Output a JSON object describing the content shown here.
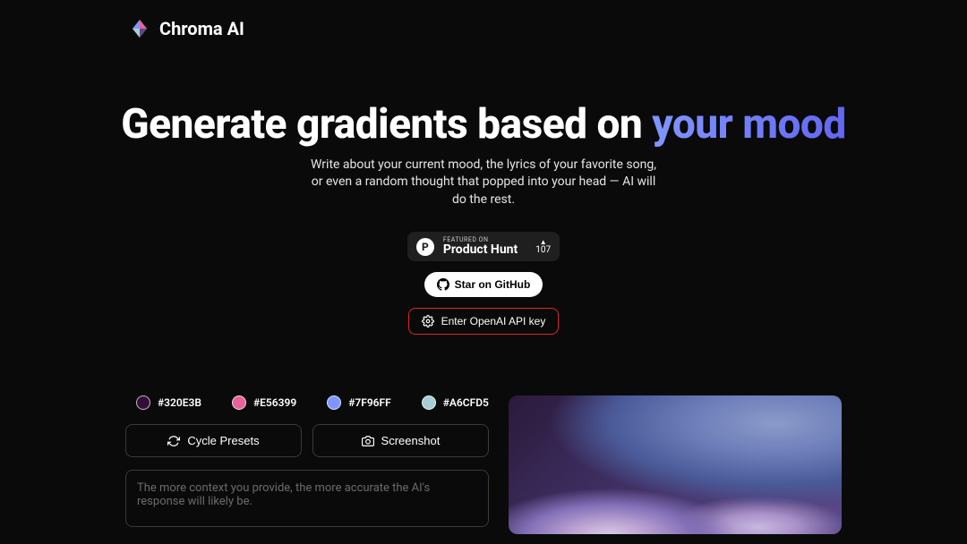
{
  "brand": "Chroma AI",
  "hero": {
    "title_prefix": "Generate gradients based on ",
    "title_highlight": "your mood",
    "subtitle": "Write about your current mood, the lyrics of your favorite song, or even a random thought that popped into your head — AI will do the rest."
  },
  "productHunt": {
    "featured_label": "FEATURED ON",
    "name": "Product Hunt",
    "upvotes": "107"
  },
  "buttons": {
    "github": "Star on GitHub",
    "api_key": "Enter OpenAI API key",
    "cycle": "Cycle Presets",
    "screenshot": "Screenshot"
  },
  "colors": [
    {
      "hex": "#320E3B"
    },
    {
      "hex": "#E56399"
    },
    {
      "hex": "#7F96FF"
    },
    {
      "hex": "#A6CFD5"
    }
  ],
  "textarea": {
    "placeholder": "The more context you provide, the more accurate the AI's response will likely be."
  }
}
